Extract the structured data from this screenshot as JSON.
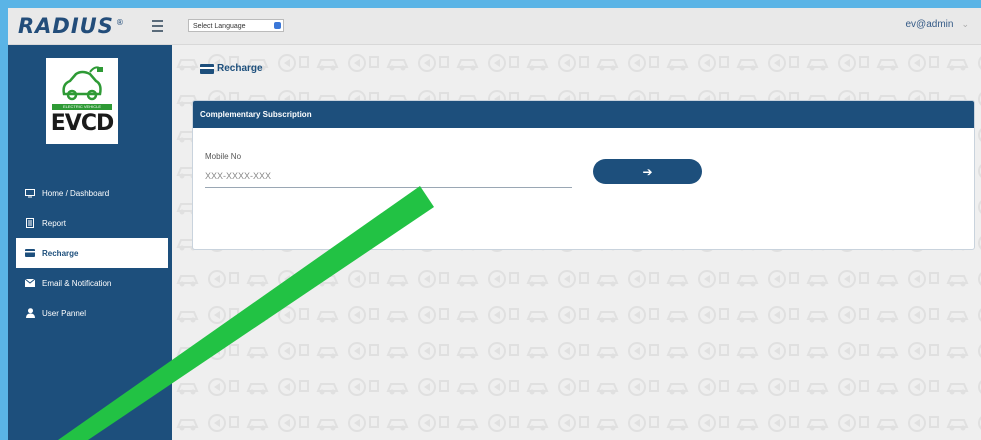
{
  "header": {
    "logo_text": "RADIUS",
    "logo_mark": "®",
    "language_select": "Select Language",
    "user": "ev@admin"
  },
  "sidebar": {
    "brand": {
      "name": "EVCD",
      "plate": "ELECTRIC VEHICLE"
    },
    "items": [
      {
        "label": "Home / Dashboard",
        "icon": "monitor-icon",
        "active": false
      },
      {
        "label": "Report",
        "icon": "document-icon",
        "active": false
      },
      {
        "label": "Recharge",
        "icon": "card-icon",
        "active": true
      },
      {
        "label": "Email & Notification",
        "icon": "envelope-icon",
        "active": false
      },
      {
        "label": "User Pannel",
        "icon": "user-icon",
        "active": false
      }
    ]
  },
  "main": {
    "page_title": "Recharge",
    "card": {
      "title": "Complementary Subscription",
      "mobile_label": "Mobile No",
      "mobile_placeholder": "XXX-XXXX-XXX",
      "submit_icon": "arrow-right-icon",
      "submit_glyph": "➔"
    }
  },
  "colors": {
    "primary": "#1d4f7c",
    "annotation": "#22c244",
    "outer_bg": "#5ab4e6"
  }
}
